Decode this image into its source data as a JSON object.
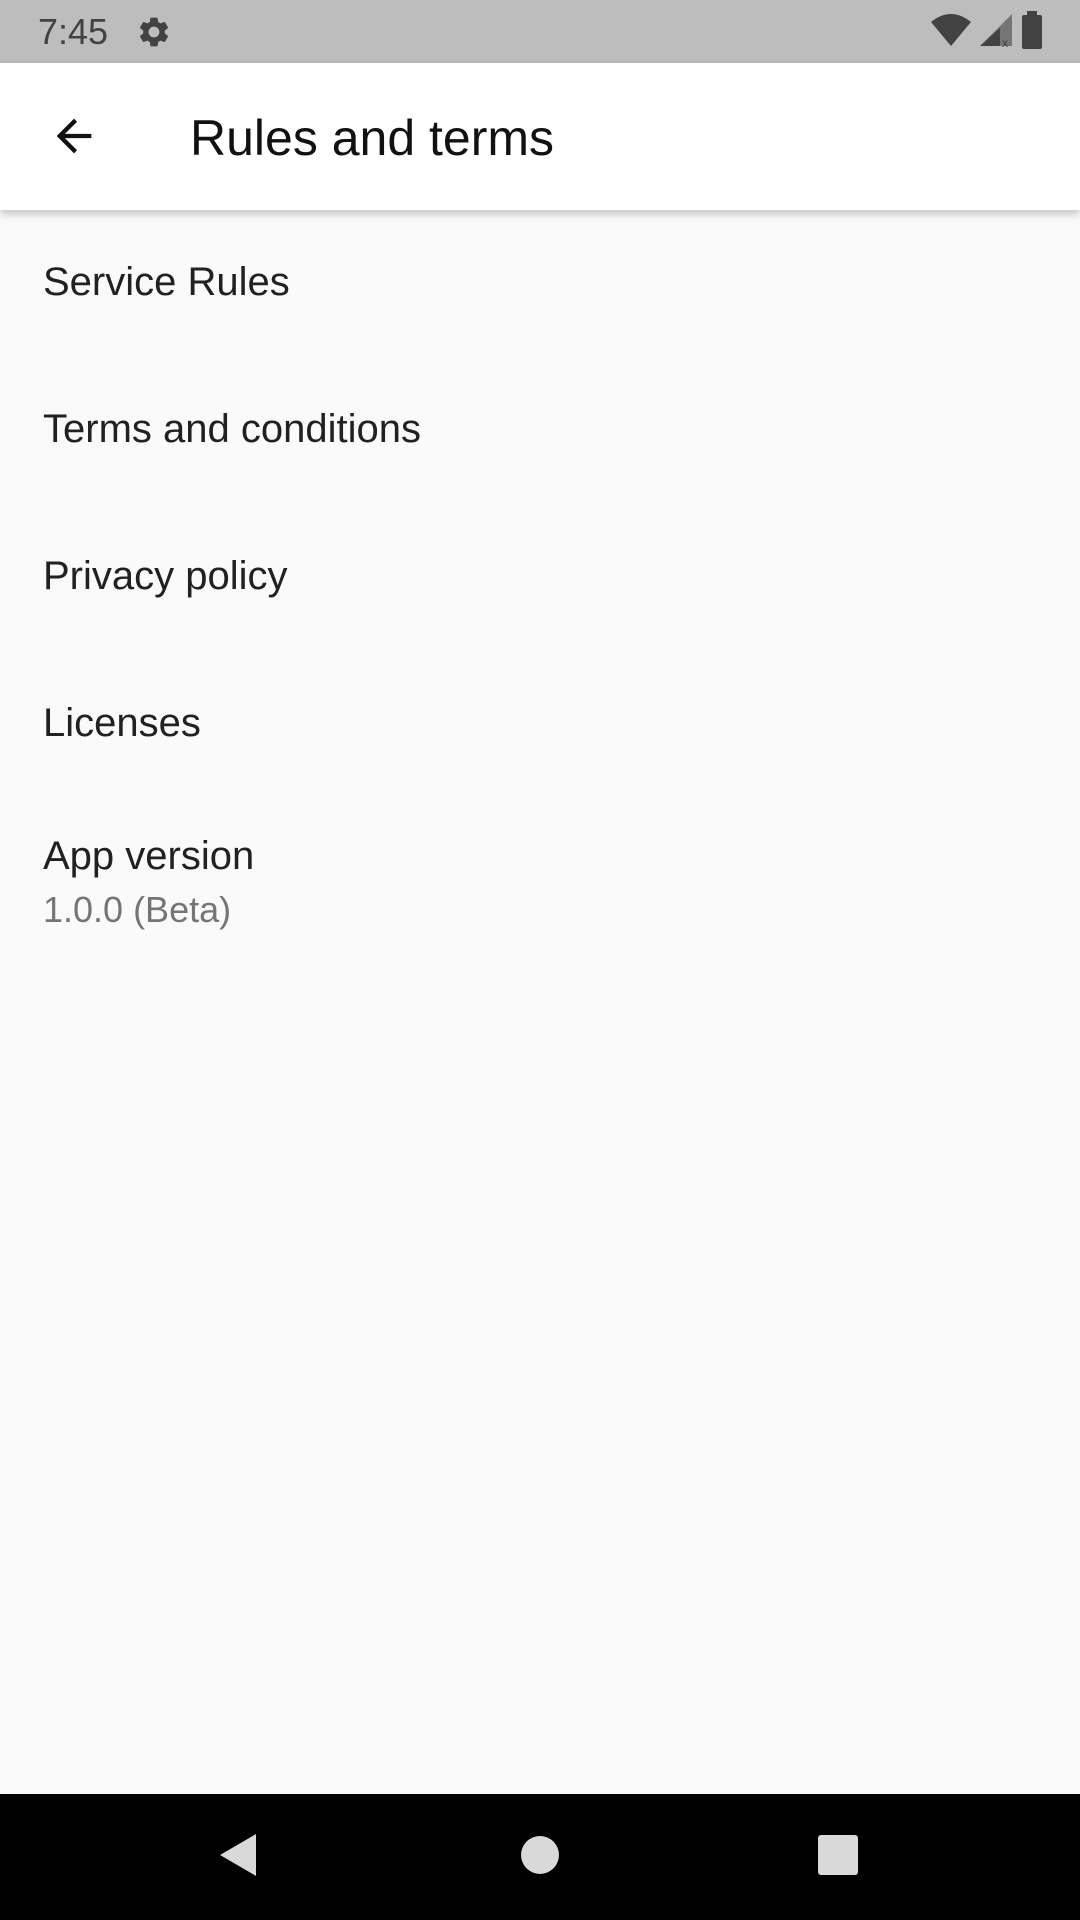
{
  "status_bar": {
    "time": "7:45",
    "icons": [
      "settings-icon",
      "wifi-icon",
      "cell-signal-icon",
      "battery-icon"
    ]
  },
  "app_bar": {
    "title": "Rules and terms",
    "back_icon": "arrow-back-icon"
  },
  "list": {
    "items": [
      {
        "label": "Service Rules"
      },
      {
        "label": "Terms and conditions"
      },
      {
        "label": "Privacy policy"
      },
      {
        "label": "Licenses"
      }
    ],
    "version": {
      "label": "App version",
      "value": "1.0.0 (Beta)"
    }
  },
  "nav_bar": {
    "icons": [
      "nav-back-icon",
      "nav-home-icon",
      "nav-recents-icon"
    ]
  },
  "colors": {
    "status_bar": "#bdbdbd",
    "app_bar": "#ffffff",
    "background": "#fafafa",
    "primary_text": "#212121",
    "secondary_text": "#757575",
    "nav_bar": "#000000"
  }
}
